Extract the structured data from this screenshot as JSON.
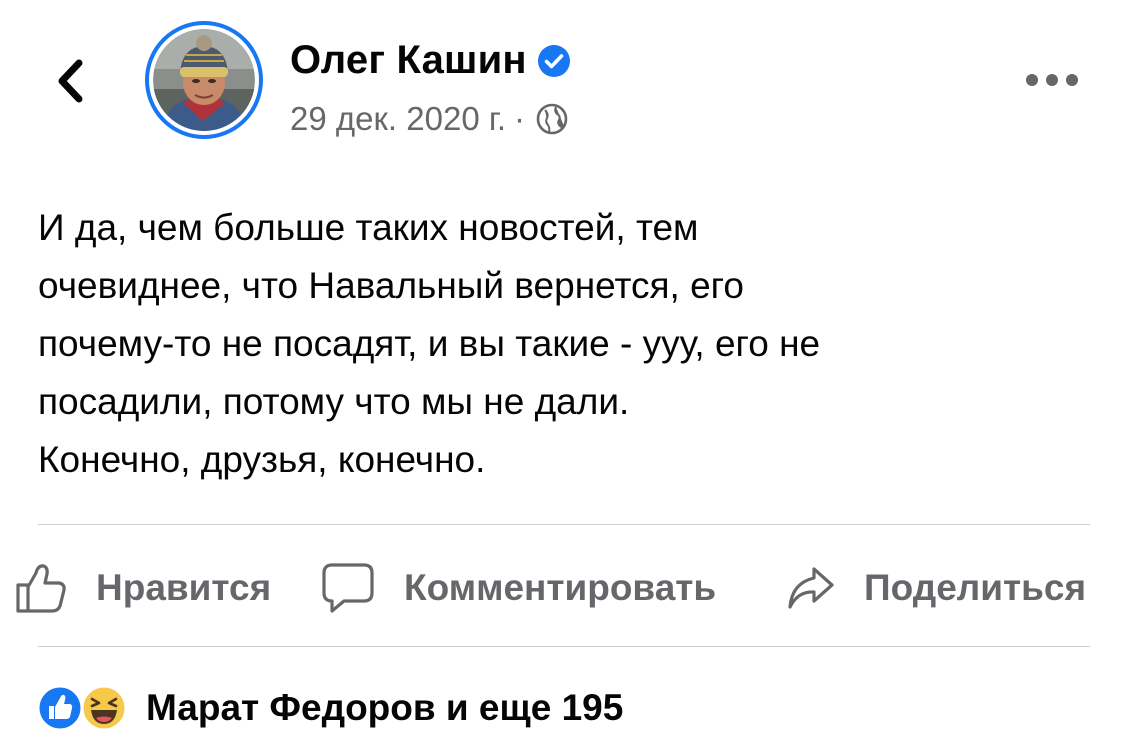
{
  "header": {
    "author_name": "Олег Кашин",
    "date": "29 дек. 2020 г.",
    "separator": "·",
    "back_icon": "chevron-left-icon",
    "privacy_icon": "globe-icon",
    "more_icon": "more-horizontal-icon",
    "verified_icon": "verified-badge-icon"
  },
  "post": {
    "text": "И да, чем больше таких новостей, тем\nочевиднее, что Навальный вернется, его\nпочему-то не посадят, и вы такие - ууу, его не\nпосадили, потому что мы не дали.\nКонечно, друзья, конечно."
  },
  "actions": {
    "like_label": "Нравится",
    "comment_label": "Комментировать",
    "share_label": "Поделиться"
  },
  "reactions": {
    "summary": "Марат Федоров и еще 195",
    "icons": [
      "like-reaction-icon",
      "haha-reaction-icon"
    ]
  },
  "colors": {
    "accent": "#1877f2",
    "secondary_text": "#65676b",
    "primary_text": "#050505",
    "divider": "#ced0d4"
  }
}
